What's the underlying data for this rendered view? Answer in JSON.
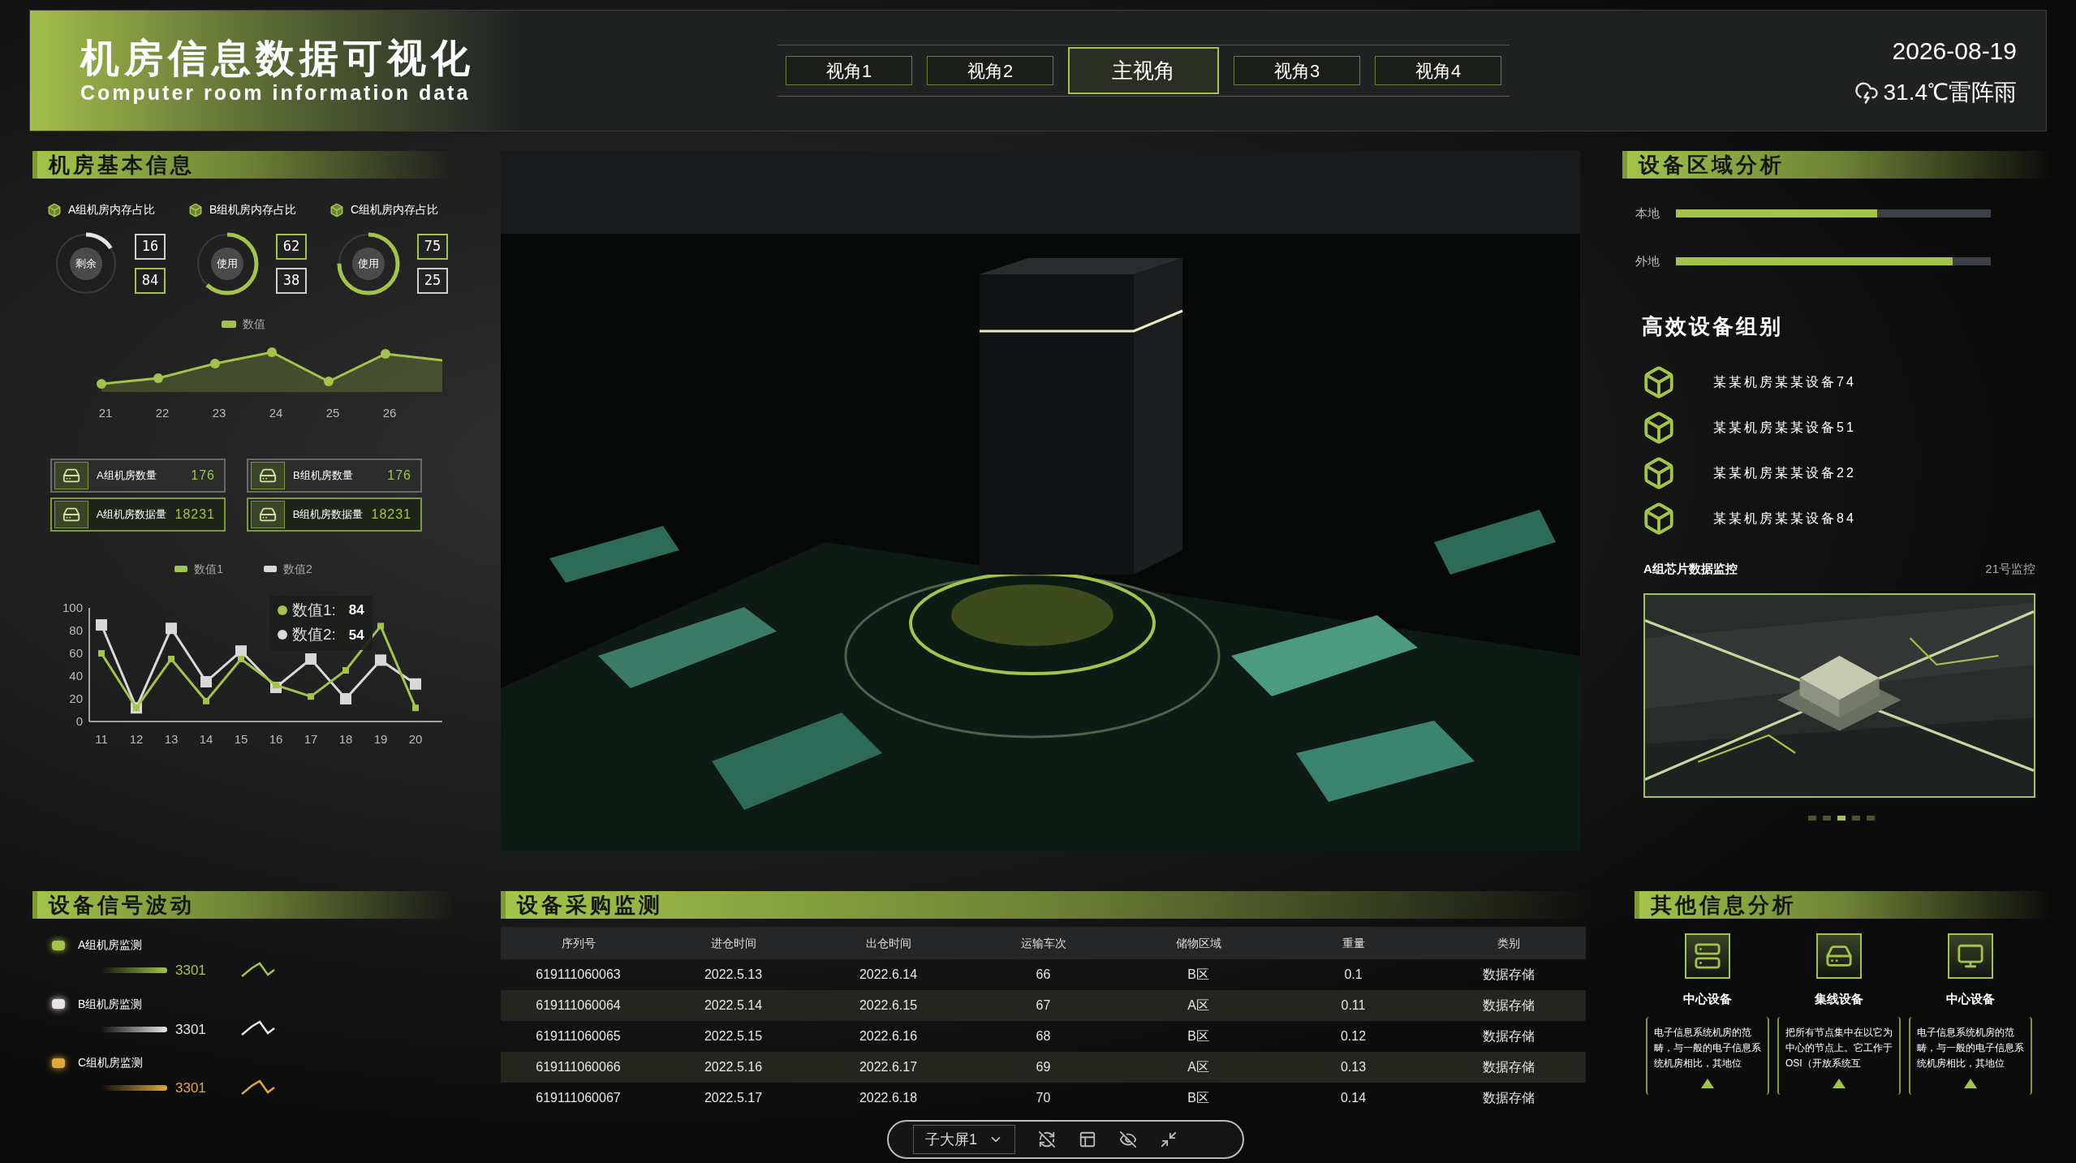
{
  "header": {
    "title": "机房信息数据可视化",
    "subtitle": "Computer room information data",
    "date": "2026-08-19",
    "weather": "31.4℃雷阵雨"
  },
  "tabs": [
    {
      "label": "视角1",
      "selected": false
    },
    {
      "label": "视角2",
      "selected": false
    },
    {
      "label": "主视角",
      "selected": true
    },
    {
      "label": "视角3",
      "selected": false
    },
    {
      "label": "视角4",
      "selected": false
    }
  ],
  "basic_info": {
    "title": "机房基本信息",
    "donuts": [
      {
        "label": "A组机房内存占比",
        "center": "剩余",
        "level": 0.16,
        "color": "#e6e6e6",
        "numbers": [
          {
            "text": "16",
            "highlighted": false
          },
          {
            "text": "84",
            "highlighted": true
          }
        ]
      },
      {
        "label": "B组机房内存占比",
        "center": "使用",
        "level": 0.62,
        "color": "#a3c44a",
        "numbers": [
          {
            "text": "62",
            "highlighted": true
          },
          {
            "text": "38",
            "highlighted": false
          }
        ]
      },
      {
        "label": "C组机房内存占比",
        "center": "使用",
        "level": 0.75,
        "color": "#a3c44a",
        "numbers": [
          {
            "text": "75",
            "highlighted": true
          },
          {
            "text": "25",
            "highlighted": false
          }
        ]
      }
    ],
    "trend": {
      "legend": "数值",
      "x_labels": [
        "21",
        "22",
        "23",
        "24",
        "25",
        "26"
      ]
    },
    "stats": [
      {
        "label": "A组机房数量",
        "value": "176",
        "kind": "count"
      },
      {
        "label": "B组机房数量",
        "value": "176",
        "kind": "count"
      },
      {
        "label": "A组机房数据量",
        "value": "18231",
        "kind": "volume"
      },
      {
        "label": "B组机房数据量",
        "value": "18231",
        "kind": "volume"
      }
    ],
    "chart_data": {
      "type": "line",
      "categories": [
        "11",
        "12",
        "13",
        "14",
        "15",
        "16",
        "17",
        "18",
        "19",
        "20"
      ],
      "ylim": [
        0,
        100
      ],
      "yticks": [
        0,
        20,
        40,
        60,
        80,
        100
      ],
      "series": [
        {
          "name": "数值1",
          "color": "#a3c44a",
          "marker": "square",
          "values": [
            60,
            12,
            55,
            18,
            55,
            32,
            22,
            45,
            84,
            12
          ]
        },
        {
          "name": "数值2",
          "color": "#d9d9d9",
          "marker": "square",
          "values": [
            85,
            12,
            82,
            35,
            62,
            30,
            55,
            20,
            54,
            33
          ]
        }
      ]
    },
    "tooltip": {
      "lines": [
        {
          "label": "数值1:",
          "value": "84",
          "color": "#a3c44a"
        },
        {
          "label": "数值2:",
          "value": "54",
          "color": "#d9d9d9"
        }
      ]
    }
  },
  "signal": {
    "title": "设备信号波动",
    "items": [
      {
        "label": "A组机房监测",
        "value": "3301",
        "color": "#a3c44a"
      },
      {
        "label": "B组机房监测",
        "value": "3301",
        "color": "#e8e4e4"
      },
      {
        "label": "C组机房监测",
        "value": "3301",
        "color": "#e0a83a"
      }
    ]
  },
  "purchase": {
    "title": "设备采购监测",
    "columns": [
      "序列号",
      "进仓时间",
      "出仓时间",
      "运输车次",
      "储物区域",
      "重量",
      "类别"
    ],
    "rows": [
      [
        "619111060063",
        "2022.5.13",
        "2022.6.14",
        "66",
        "B区",
        "0.1",
        "数据存储"
      ],
      [
        "619111060064",
        "2022.5.14",
        "2022.6.15",
        "67",
        "A区",
        "0.11",
        "数据存储"
      ],
      [
        "619111060065",
        "2022.5.15",
        "2022.6.16",
        "68",
        "B区",
        "0.12",
        "数据存储"
      ],
      [
        "619111060066",
        "2022.5.16",
        "2022.6.17",
        "69",
        "A区",
        "0.13",
        "数据存储"
      ],
      [
        "619111060067",
        "2022.5.17",
        "2022.6.18",
        "70",
        "B区",
        "0.14",
        "数据存储"
      ]
    ]
  },
  "toolbar": {
    "screen": "子大屏1"
  },
  "region": {
    "title": "设备区域分析",
    "bars": [
      {
        "label": "本地",
        "level": 0.64
      },
      {
        "label": "外地",
        "level": 0.88
      }
    ],
    "group_title": "高效设备组别",
    "devices": [
      "某某机房某某设备74",
      "某某机房某某设备51",
      "某某机房某某设备22",
      "某某机房某某设备84"
    ],
    "monitor_title": "A组芯片数据监控",
    "monitor_tag": "21号监控",
    "dots": [
      {
        "selected": false
      },
      {
        "selected": false
      },
      {
        "selected": true
      },
      {
        "selected": false
      },
      {
        "selected": false
      }
    ]
  },
  "other": {
    "title": "其他信息分析",
    "cards": [
      {
        "label": "中心设备",
        "kind": "server",
        "text": "电子信息系统机房的范畴，与一般的电子信息系统机房相比，其地位"
      },
      {
        "label": "集线设备",
        "kind": "hub",
        "text": "把所有节点集中在以它为中心的节点上。它工作于OSI（开放系统互"
      },
      {
        "label": "中心设备",
        "kind": "monitor",
        "text": "电子信息系统机房的范畴，与一般的电子信息系统机房相比，其地位"
      }
    ]
  }
}
